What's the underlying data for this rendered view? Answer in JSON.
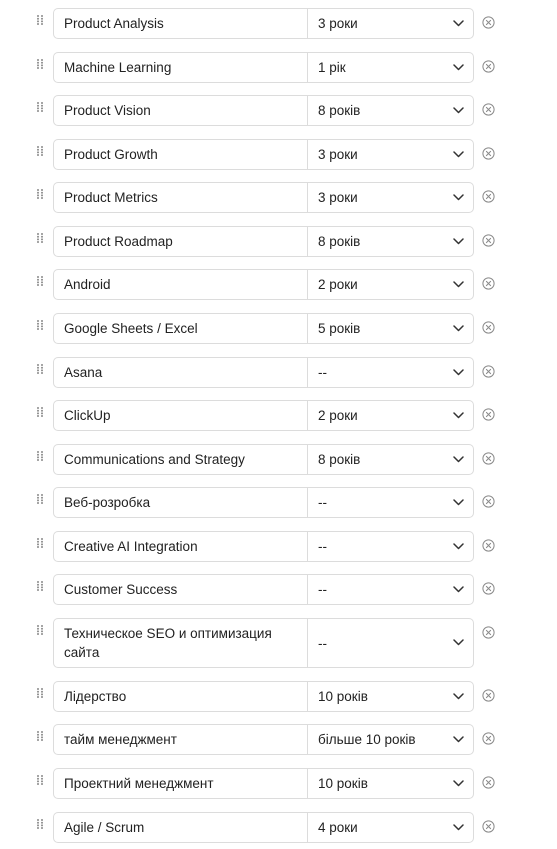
{
  "icons": {
    "drag": "drag-handle-icon",
    "dropdown": "chevron-down-icon",
    "remove": "close-circle-icon"
  },
  "colors": {
    "border": "#dcdcdc",
    "icon": "#8a8a8a",
    "text": "#222222"
  },
  "skills": [
    {
      "name": "Product Analysis",
      "level": "3 роки"
    },
    {
      "name": "Machine Learning",
      "level": "1 рік"
    },
    {
      "name": "Product Vision",
      "level": "8 років"
    },
    {
      "name": "Product Growth",
      "level": "3 роки"
    },
    {
      "name": "Product Metrics",
      "level": "3 роки"
    },
    {
      "name": "Product Roadmap",
      "level": "8 років"
    },
    {
      "name": "Android",
      "level": "2 роки"
    },
    {
      "name": "Google Sheets / Excel",
      "level": "5 років"
    },
    {
      "name": "Asana",
      "level": "--"
    },
    {
      "name": "ClickUp",
      "level": "2 роки"
    },
    {
      "name": "Communications and Strategy",
      "level": "8 років"
    },
    {
      "name": "Веб-розробка",
      "level": "--"
    },
    {
      "name": "Creative AI Integration",
      "level": "--"
    },
    {
      "name": "Customer Success",
      "level": "--"
    },
    {
      "name": "Техническое SEO и оптимизация сайта",
      "level": "--"
    },
    {
      "name": "Лідерство",
      "level": "10 років"
    },
    {
      "name": "тайм менеджмент",
      "level": "більше 10 років"
    },
    {
      "name": "Проектний менеджмент",
      "level": "10 років"
    },
    {
      "name": "Agile / Scrum",
      "level": "4 роки"
    }
  ]
}
